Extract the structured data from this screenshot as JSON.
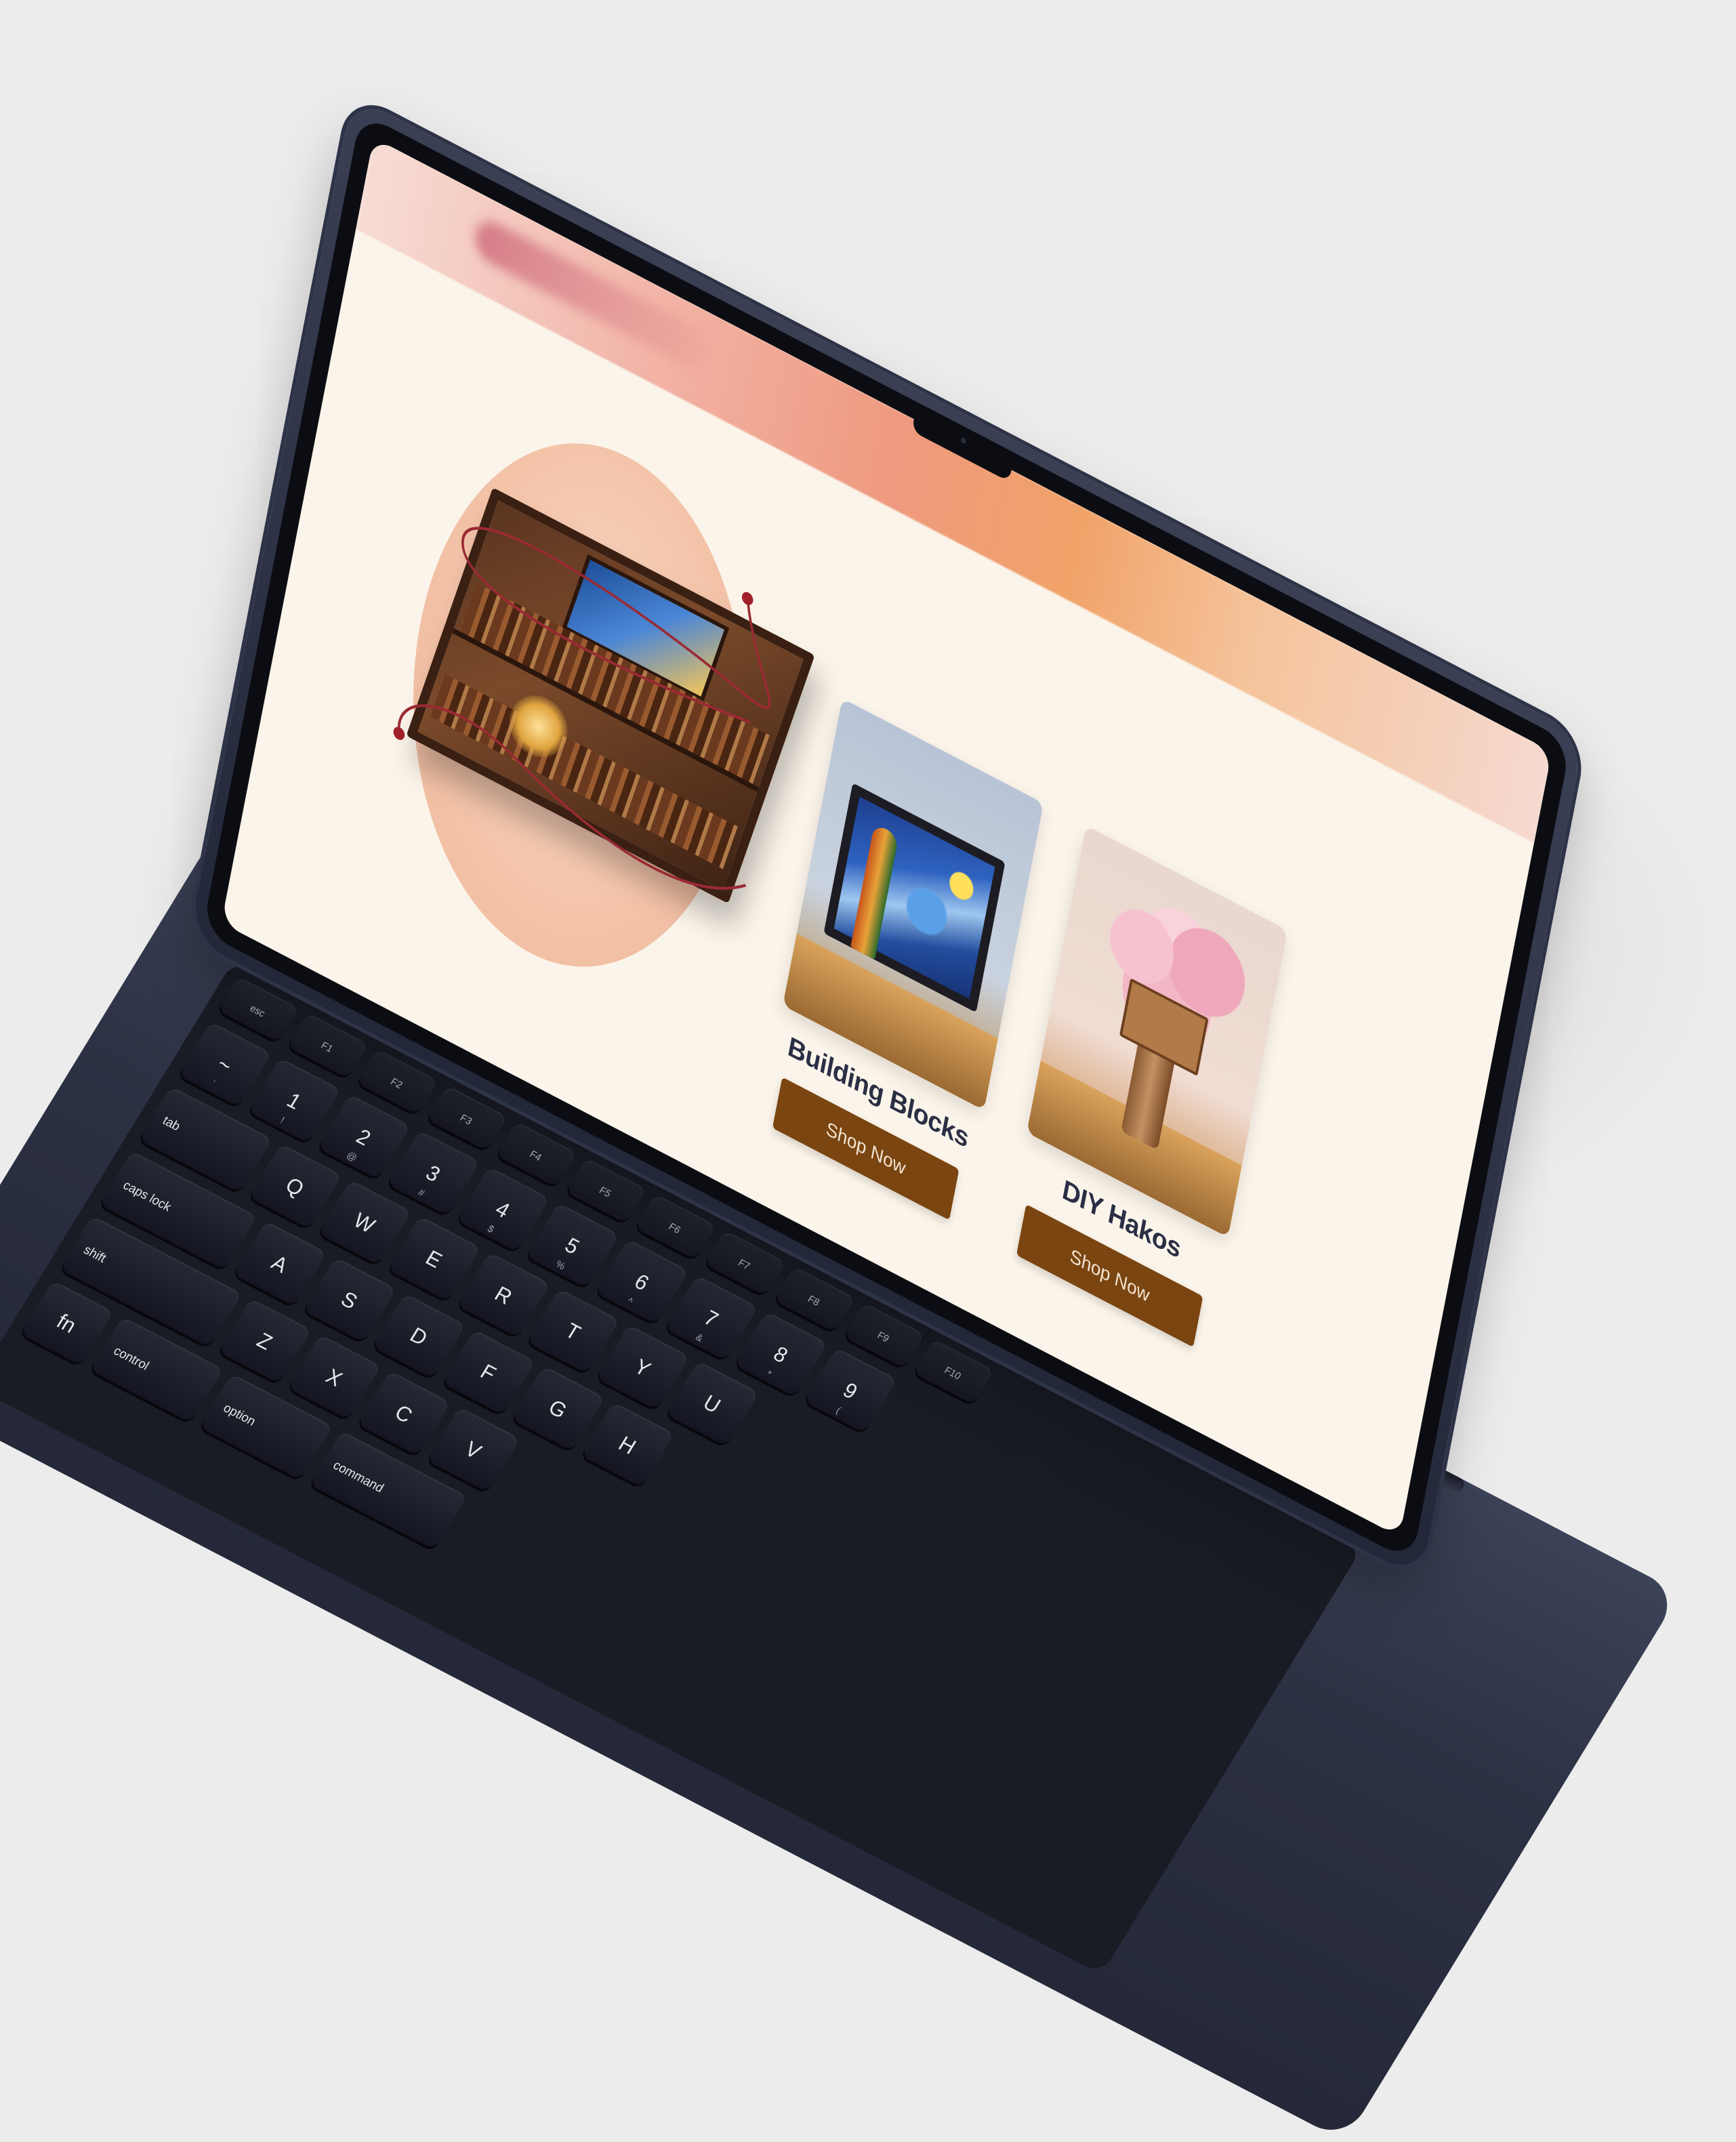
{
  "page": {
    "background": "#ececec",
    "accent": "#7a4510",
    "screen_bg": "#fbf4ea"
  },
  "products": [
    {
      "title": "Building Blocks",
      "button_label": "Shop Now"
    },
    {
      "title": "DIY Hakos",
      "button_label": "Shop Now"
    }
  ],
  "featured": {
    "icon": "book-nook-illustration"
  },
  "keyboard": {
    "function_row": [
      "esc",
      "F1",
      "F2",
      "F3",
      "F4",
      "F5",
      "F6",
      "F7",
      "F8",
      "F9",
      "F10"
    ],
    "number_row": [
      {
        "main": "~",
        "sub": "`"
      },
      {
        "main": "1",
        "sub": "!"
      },
      {
        "main": "2",
        "sub": "@"
      },
      {
        "main": "3",
        "sub": "#"
      },
      {
        "main": "4",
        "sub": "$"
      },
      {
        "main": "5",
        "sub": "%"
      },
      {
        "main": "6",
        "sub": "^"
      },
      {
        "main": "7",
        "sub": "&"
      },
      {
        "main": "8",
        "sub": "*"
      },
      {
        "main": "9",
        "sub": "("
      }
    ],
    "tab_label": "tab",
    "qwerty_row": [
      "Q",
      "W",
      "E",
      "R",
      "T",
      "Y",
      "U"
    ],
    "caps_label": "caps lock",
    "asdf_row": [
      "A",
      "S",
      "D",
      "F",
      "G",
      "H"
    ],
    "shift_label": "shift",
    "zxcv_row": [
      "Z",
      "X",
      "C",
      "V"
    ],
    "fn_label": "fn",
    "control_label": "control",
    "option_label": "option",
    "command_label": "command"
  }
}
